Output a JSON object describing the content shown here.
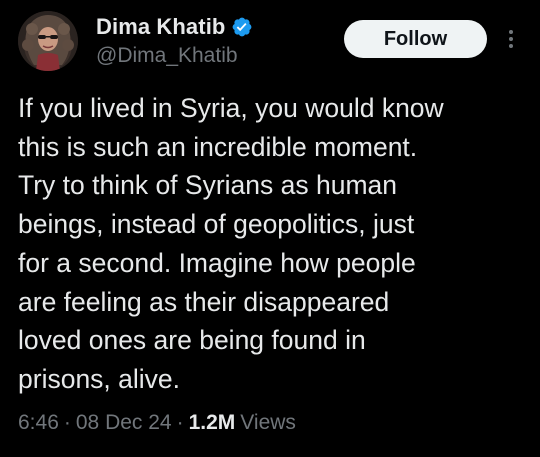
{
  "author": {
    "display_name": "Dima Khatib",
    "handle": "@Dima_Khatib",
    "verified": true
  },
  "actions": {
    "follow_label": "Follow",
    "more_icon": "more-vertical-icon"
  },
  "tweet": {
    "lines": [
      "If you lived in Syria, you would know",
      "this is such an incredible moment.",
      "Try to think of Syrians as human",
      "beings, instead of geopolitics, just",
      "for a second. Imagine how people",
      "are feeling as their disappeared",
      "loved ones are being found in",
      "prisons, alive."
    ]
  },
  "meta": {
    "time": "6:46",
    "separator": "·",
    "date": "08 Dec 24",
    "views_count": "1.2M",
    "views_label": "Views"
  },
  "colors": {
    "background": "#000000",
    "text_primary": "#e7e9ea",
    "text_secondary": "#71767b",
    "verified_badge": "#1d9bf0",
    "follow_bg": "#eff3f4",
    "follow_text": "#0f1419"
  }
}
